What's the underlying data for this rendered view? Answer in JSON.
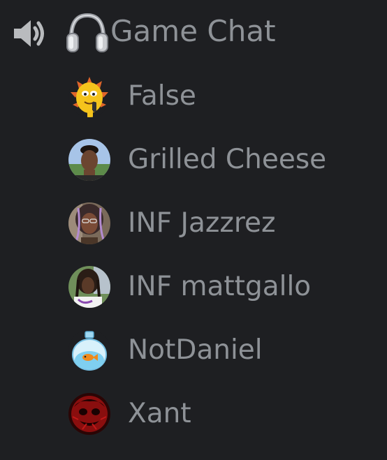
{
  "channel": {
    "name": "Game Chat",
    "icon": "speaker-icon",
    "activity_icon": "headphones-emoji-icon"
  },
  "users": [
    {
      "name": "False",
      "avatar": "cartoon-mascot-avatar"
    },
    {
      "name": "Grilled Cheese",
      "avatar": "photo-avatar"
    },
    {
      "name": "INF Jazzrez",
      "avatar": "photo-avatar"
    },
    {
      "name": "INF mattgallo",
      "avatar": "photo-avatar"
    },
    {
      "name": "NotDaniel",
      "avatar": "fishbowl-avatar"
    },
    {
      "name": "Xant",
      "avatar": "red-dark-art-avatar"
    }
  ],
  "colors": {
    "background": "#1e1f22",
    "text": "#8e9297"
  }
}
